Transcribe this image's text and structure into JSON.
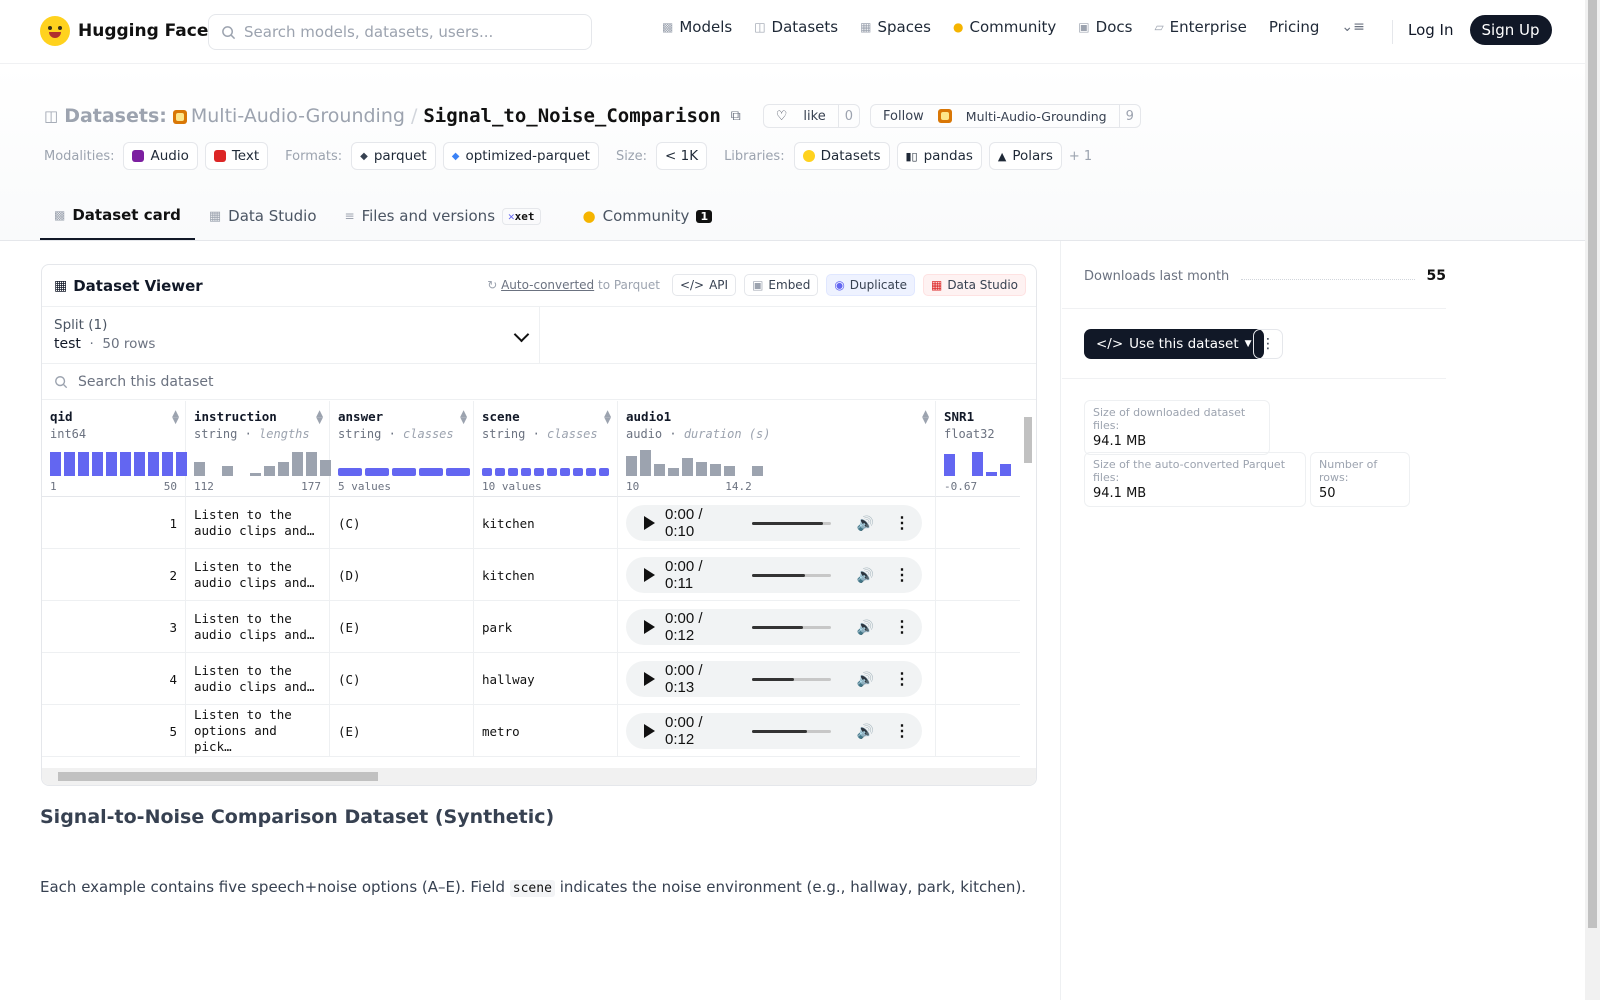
{
  "nav": {
    "brand": "Hugging Face",
    "search_placeholder": "Search models, datasets, users...",
    "links": [
      "Models",
      "Datasets",
      "Spaces",
      "Community",
      "Docs",
      "Enterprise",
      "Pricing"
    ],
    "login": "Log In",
    "signup": "Sign Up"
  },
  "header": {
    "section": "Datasets:",
    "org": "Multi-Audio-Grounding",
    "slash": "/",
    "name": "Signal_to_Noise_Comparison",
    "like": "like",
    "like_count": "0",
    "follow": "Follow",
    "follow_org": "Multi-Audio-Grounding",
    "follow_count": "9"
  },
  "meta": {
    "modalities_label": "Modalities:",
    "modalities": [
      "Audio",
      "Text"
    ],
    "formats_label": "Formats:",
    "formats": [
      "parquet",
      "optimized-parquet"
    ],
    "size_label": "Size:",
    "size": "< 1K",
    "libraries_label": "Libraries:",
    "libraries": [
      "Datasets",
      "pandas",
      "Polars"
    ],
    "more": "+ 1"
  },
  "tabs": {
    "card": "Dataset card",
    "studio": "Data Studio",
    "files": "Files and versions",
    "xet": "xet",
    "community": "Community",
    "community_count": "1"
  },
  "sidebar": {
    "downloads_label": "Downloads last month",
    "downloads": "55",
    "use_button": "Use this dataset",
    "stats": {
      "download_size_label": "Size of downloaded dataset files:",
      "download_size": "94.1 MB",
      "parquet_size_label": "Size of the auto-converted Parquet files:",
      "parquet_size": "94.1 MB",
      "rows_label": "Number of rows:",
      "rows": "50"
    }
  },
  "viewer": {
    "title": "Dataset Viewer",
    "auto_link": "Auto-converted",
    "auto_rest": " to Parquet",
    "api": "API",
    "embed": "Embed",
    "duplicate": "Duplicate",
    "studio": "Data Studio",
    "split_label": "Split (1)",
    "split_name": "test",
    "split_rows": "50 rows",
    "search_placeholder": "Search this dataset",
    "columns": [
      {
        "name": "qid",
        "type": "int64",
        "stat": "",
        "range": [
          "1",
          "50"
        ]
      },
      {
        "name": "instruction",
        "type": "string",
        "stat": "lengths",
        "range": [
          "112",
          "177"
        ]
      },
      {
        "name": "answer",
        "type": "string",
        "stat": "classes",
        "range": [
          "5 values",
          ""
        ]
      },
      {
        "name": "scene",
        "type": "string",
        "stat": "classes",
        "range": [
          "10 values",
          ""
        ]
      },
      {
        "name": "audio1",
        "type": "audio",
        "stat": "duration (s)",
        "range": [
          "10",
          "14.2"
        ]
      },
      {
        "name": "SNR1",
        "type": "float32",
        "stat": "",
        "range": [
          "-0.67",
          ""
        ]
      }
    ],
    "rows": [
      {
        "qid": "1",
        "instruction": "Listen to the\naudio clips and…",
        "answer": "(C)",
        "scene": "kitchen",
        "time": "0:00 / 0:10",
        "progress": 0.9
      },
      {
        "qid": "2",
        "instruction": "Listen to the\naudio clips and…",
        "answer": "(D)",
        "scene": "kitchen",
        "time": "0:00 / 0:11",
        "progress": 0.67
      },
      {
        "qid": "3",
        "instruction": "Listen to the\naudio clips and…",
        "answer": "(E)",
        "scene": "park",
        "time": "0:00 / 0:12",
        "progress": 0.65
      },
      {
        "qid": "4",
        "instruction": "Listen to the\naudio clips and…",
        "answer": "(C)",
        "scene": "hallway",
        "time": "0:00 / 0:13",
        "progress": 0.53
      },
      {
        "qid": "5",
        "instruction": "Listen to the\noptions and pick…",
        "answer": "(E)",
        "scene": "metro",
        "time": "0:00 / 0:12",
        "progress": 0.7
      }
    ]
  },
  "card": {
    "heading": "Signal-to-Noise Comparison Dataset (Synthetic)",
    "para_before": "Each example contains five speech+noise options (A–E). Field ",
    "para_code": "scene",
    "para_after": " indicates the noise environment (e.g., hallway, park, kitchen)."
  }
}
